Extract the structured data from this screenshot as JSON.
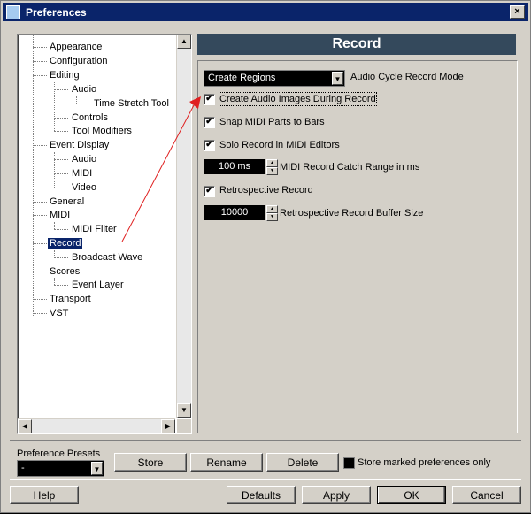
{
  "window": {
    "title": "Preferences",
    "close_label": "×"
  },
  "tree": {
    "items": [
      {
        "label": "Appearance"
      },
      {
        "label": "Configuration"
      },
      {
        "label": "Editing"
      },
      {
        "label": "Audio"
      },
      {
        "label": "Time Stretch Tool"
      },
      {
        "label": "Controls"
      },
      {
        "label": "Tool Modifiers"
      },
      {
        "label": "Event Display"
      },
      {
        "label": "Audio"
      },
      {
        "label": "MIDI"
      },
      {
        "label": "Video"
      },
      {
        "label": "General"
      },
      {
        "label": "MIDI"
      },
      {
        "label": "MIDI Filter"
      },
      {
        "label": "Record",
        "selected": true
      },
      {
        "label": "Broadcast Wave"
      },
      {
        "label": "Scores"
      },
      {
        "label": "Event Layer"
      },
      {
        "label": "Transport"
      },
      {
        "label": "VST"
      }
    ]
  },
  "panel": {
    "title": "Record",
    "cycle_mode_value": "Create Regions",
    "cycle_mode_label": "Audio Cycle Record Mode",
    "create_images_label": "Create Audio Images During Record",
    "snap_midi_label": "Snap MIDI Parts to Bars",
    "solo_record_label": "Solo Record in MIDI Editors",
    "catch_range_value": "100 ms",
    "catch_range_label": "MIDI Record Catch Range in ms",
    "retro_label": "Retrospective Record",
    "retro_buffer_value": "10000",
    "retro_buffer_label": "Retrospective Record Buffer Size"
  },
  "presets": {
    "label": "Preference Presets",
    "value": "-",
    "store_label": "Store",
    "rename_label": "Rename",
    "delete_label": "Delete",
    "store_marked_label": "Store marked preferences only"
  },
  "buttons": {
    "help": "Help",
    "defaults": "Defaults",
    "apply": "Apply",
    "ok": "OK",
    "cancel": "Cancel"
  },
  "colors": {
    "accent": "#0a246a",
    "panel_header": "#34495c",
    "annotation": "#e02020"
  }
}
